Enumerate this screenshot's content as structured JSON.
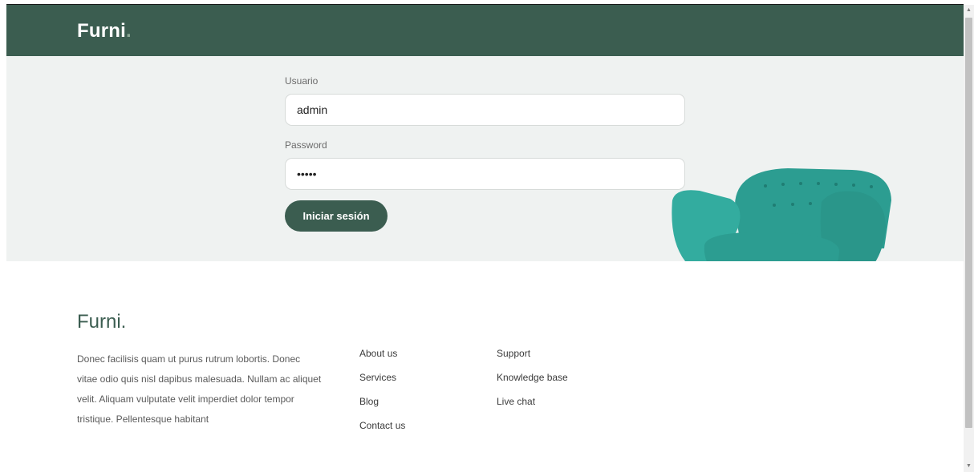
{
  "nav": {
    "brand": "Furni",
    "brand_dot": "."
  },
  "login": {
    "username_label": "Usuario",
    "username_value": "admin",
    "password_label": "Password",
    "password_value": "admin",
    "submit_label": "Iniciar sesión"
  },
  "footer": {
    "brand": "Furni.",
    "description": "Donec facilisis quam ut purus rutrum lobortis. Donec vitae odio quis nisl dapibus malesuada. Nullam ac aliquet velit. Aliquam vulputate velit imperdiet dolor tempor tristique. Pellentesque habitant",
    "links_col1": [
      "About us",
      "Services",
      "Blog",
      "Contact us"
    ],
    "links_col2": [
      "Support",
      "Knowledge base",
      "Live chat"
    ]
  },
  "colors": {
    "primary": "#3b5d50",
    "light_bg": "#eff2f1",
    "armchair": "#2a9d8f"
  },
  "icons": {
    "hero_image": "armchair-image",
    "scroll_up": "chevron-up-icon",
    "scroll_down": "chevron-down-icon"
  }
}
